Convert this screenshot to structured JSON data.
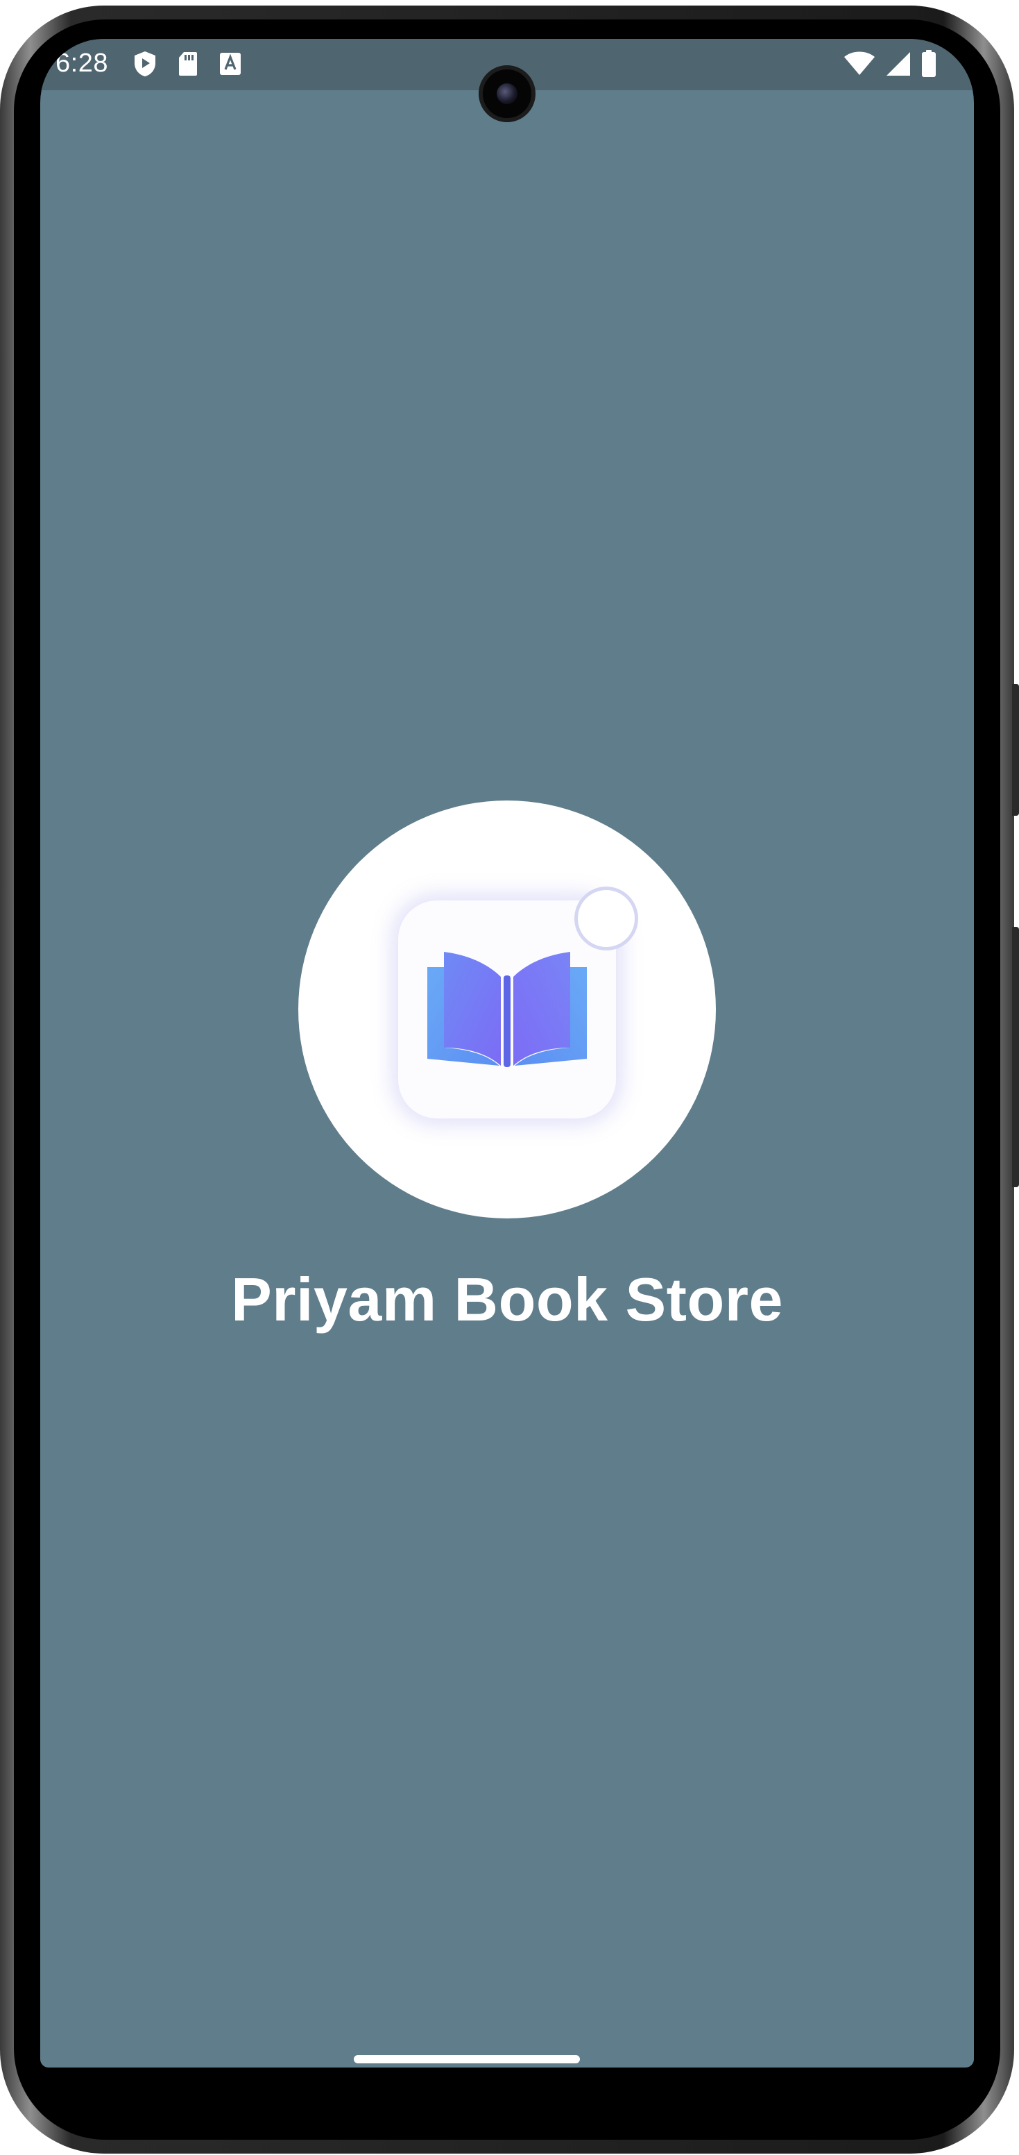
{
  "status_bar": {
    "time": "6:28",
    "left_icons": [
      "shield-play-icon",
      "sd-card-icon",
      "font-a-icon"
    ],
    "right_icons": [
      "wifi-icon",
      "cellular-signal-icon",
      "battery-icon"
    ]
  },
  "splash": {
    "app_name": "Priyam Book Store",
    "logo_icon": "open-book-icon",
    "background_color": "#607d8b",
    "accent_colors": [
      "#63a6f5",
      "#7c6cf5"
    ]
  }
}
